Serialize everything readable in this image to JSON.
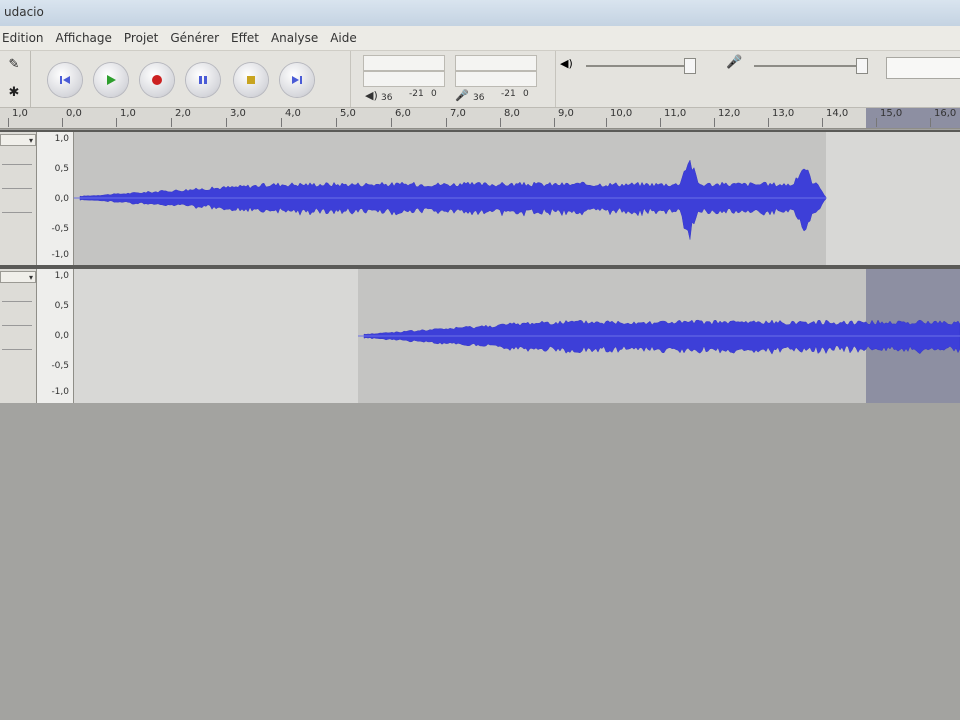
{
  "window": {
    "title": "udacio"
  },
  "menu": [
    "Edition",
    "Affichage",
    "Projet",
    "Générer",
    "Effet",
    "Analyse",
    "Aide"
  ],
  "transport": [
    {
      "name": "skip-start-button",
      "icon": "skip-start-icon",
      "color": "#4a5bd6"
    },
    {
      "name": "play-button",
      "icon": "play-icon",
      "color": "#2e9f2e"
    },
    {
      "name": "record-button",
      "icon": "record-icon",
      "color": "#cc2020"
    },
    {
      "name": "pause-button",
      "icon": "pause-icon",
      "color": "#4a5bd6"
    },
    {
      "name": "stop-button",
      "icon": "stop-icon",
      "color": "#c8a420"
    },
    {
      "name": "skip-end-button",
      "icon": "skip-end-icon",
      "color": "#4a5bd6"
    }
  ],
  "meters": {
    "out_db": "-21",
    "out_zero": "0",
    "in_db": "-21",
    "in_zero": "0",
    "left_label": "36",
    "right_label": "36"
  },
  "ruler": [
    "1,0",
    "0,0",
    "1,0",
    "2,0",
    "3,0",
    "4,0",
    "5,0",
    "6,0",
    "7,0",
    "8,0",
    "9,0",
    "10,0",
    "11,0",
    "12,0",
    "13,0",
    "14,0",
    "15,0",
    "16,0"
  ],
  "tracks": [
    {
      "name": "",
      "scale": [
        "1,0",
        "0,5",
        "0,0",
        "-0,5",
        "-1,0"
      ]
    },
    {
      "name": "",
      "scale": [
        "1,0",
        "0,5",
        "0,0",
        "-0,5",
        "-1,0"
      ]
    }
  ],
  "colors": {
    "wave": "#3d3fd8",
    "wave_light": "#6c72e8",
    "selection": "#8d8fa2"
  }
}
